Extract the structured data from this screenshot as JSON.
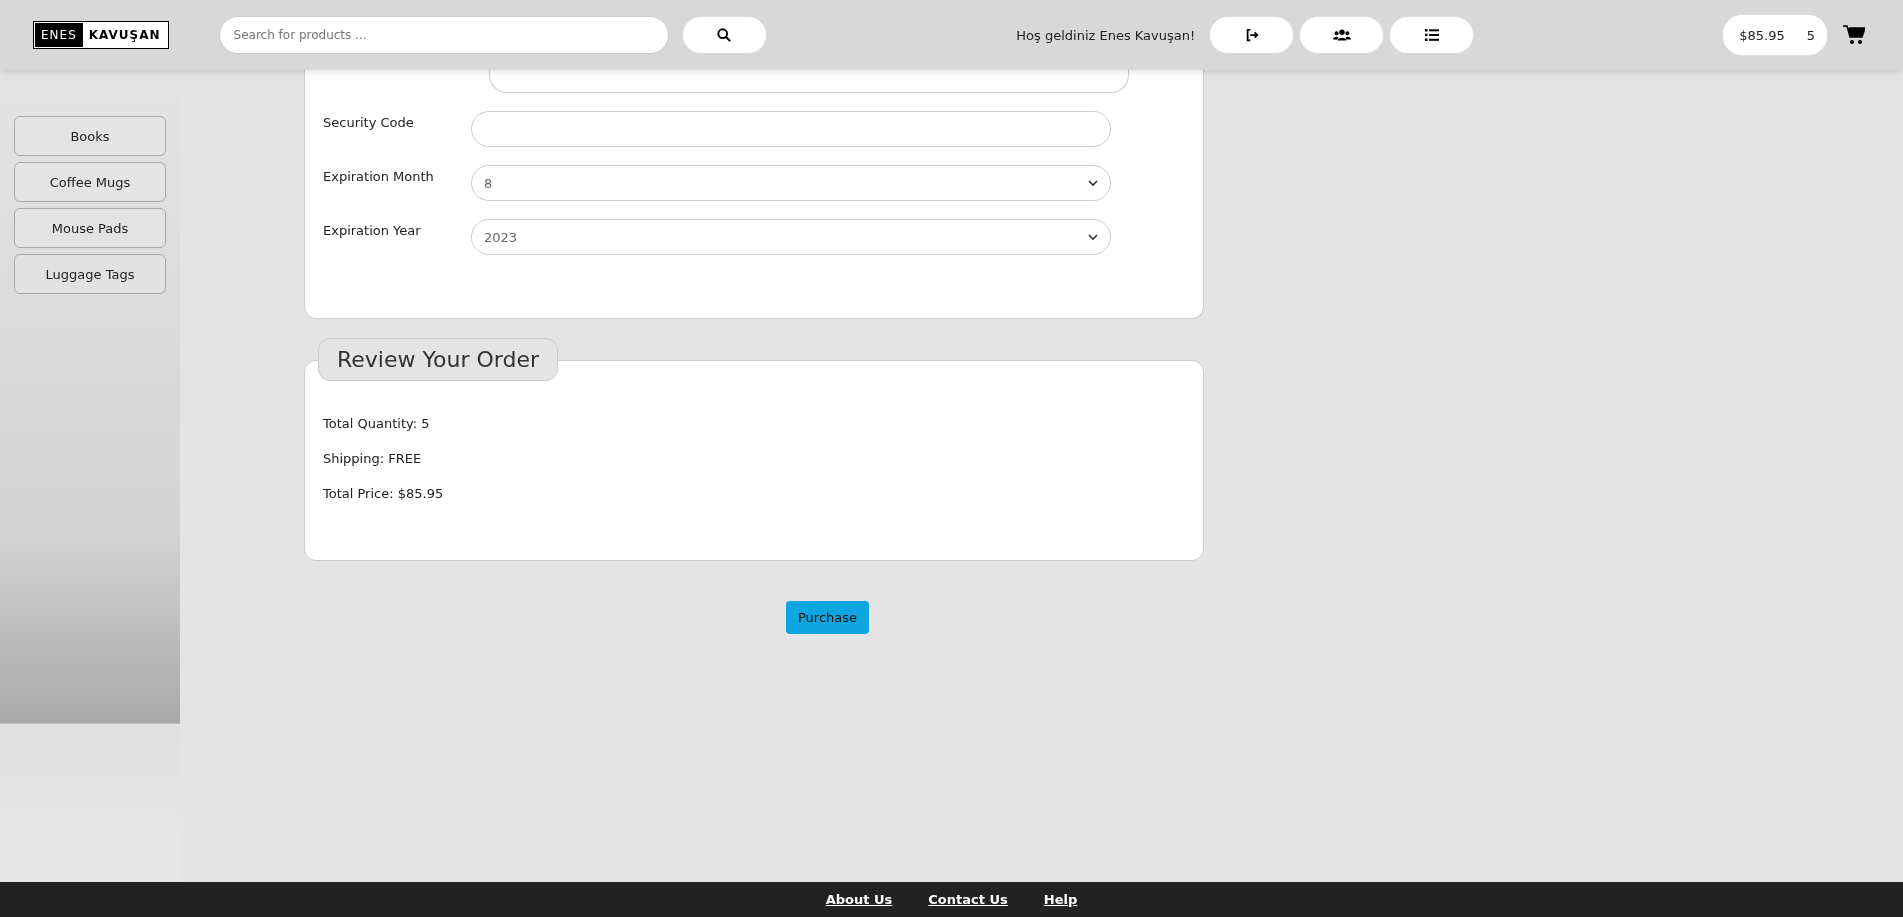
{
  "header": {
    "logo": {
      "left": "ENES",
      "right": "KAVUŞAN"
    },
    "search": {
      "placeholder": "Search for products ..."
    },
    "welcome": "Hoş geldiniz Enes Kavuşan!",
    "actions": [
      {
        "kind": "logout"
      },
      {
        "kind": "users"
      },
      {
        "kind": "list"
      }
    ],
    "cart": {
      "total": "$85.95",
      "count": "5"
    }
  },
  "sidebar": {
    "items": [
      {
        "label": "Books"
      },
      {
        "label": "Coffee Mugs"
      },
      {
        "label": "Mouse Pads"
      },
      {
        "label": "Luggage Tags"
      }
    ]
  },
  "payment": {
    "fields": [
      {
        "kind": "cut"
      },
      {
        "label": "Security Code",
        "kind": "text"
      },
      {
        "label": "Expiration Month",
        "kind": "select",
        "value": "8"
      },
      {
        "label": "Expiration Year",
        "kind": "select",
        "value": "2023"
      }
    ]
  },
  "review": {
    "title": "Review Your Order",
    "lines": [
      "Total Quantity: 5",
      "Shipping: FREE",
      "Total Price: $85.95"
    ]
  },
  "purchase_button": "Purchase",
  "footer": {
    "links": [
      "About Us",
      "Contact Us",
      "Help"
    ]
  }
}
